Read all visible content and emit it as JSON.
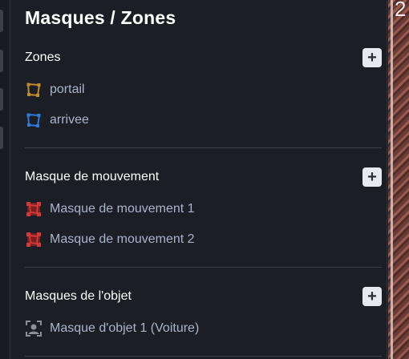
{
  "panel": {
    "title": "Masques / Zones"
  },
  "sections": [
    {
      "title": "Zones",
      "add_label": "+",
      "items": [
        {
          "label": "portail",
          "icon": "zone-polygon-icon",
          "color": "#c08a2e"
        },
        {
          "label": "arrivee",
          "icon": "zone-polygon-icon",
          "color": "#2f7ad8"
        }
      ]
    },
    {
      "title": "Masque de mouvement",
      "add_label": "+",
      "items": [
        {
          "label": "Masque de mouvement 1",
          "icon": "motion-mask-icon",
          "color": "#d23a3a"
        },
        {
          "label": "Masque de mouvement 2",
          "icon": "motion-mask-icon",
          "color": "#d23a3a"
        }
      ]
    },
    {
      "title": "Masques de l'objet",
      "add_label": "+",
      "items": [
        {
          "label": "Masque d'objet 1 (Voiture)",
          "icon": "object-mask-icon",
          "color": "#8a8f99"
        }
      ]
    }
  ],
  "video_preview": {
    "partial_text": "2"
  }
}
